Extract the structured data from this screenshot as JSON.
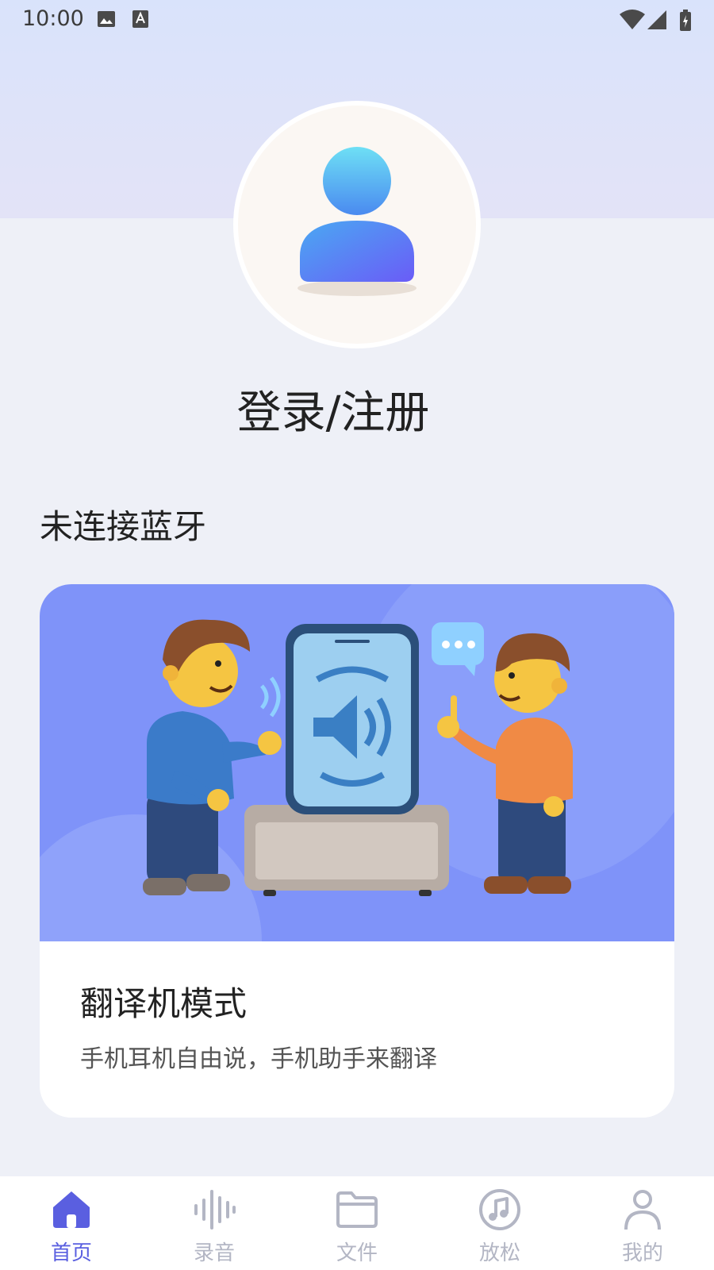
{
  "status_bar": {
    "time": "10:00"
  },
  "header": {
    "login_label": "登录/注册"
  },
  "bluetooth": {
    "status_label": "未连接蓝牙"
  },
  "mode_card": {
    "title": "翻译机模式",
    "subtitle": "手机耳机自由说，手机助手来翻译"
  },
  "bottom_nav": {
    "items": [
      {
        "label": "首页",
        "icon": "home-icon",
        "active": true
      },
      {
        "label": "录音",
        "icon": "waveform-icon",
        "active": false
      },
      {
        "label": "文件",
        "icon": "folder-icon",
        "active": false
      },
      {
        "label": "放松",
        "icon": "music-note-icon",
        "active": false
      },
      {
        "label": "我的",
        "icon": "person-icon",
        "active": false
      }
    ]
  },
  "colors": {
    "accent": "#5a5fe0",
    "inactive": "#b3b6c4",
    "card_bg": "#7f93f9"
  }
}
